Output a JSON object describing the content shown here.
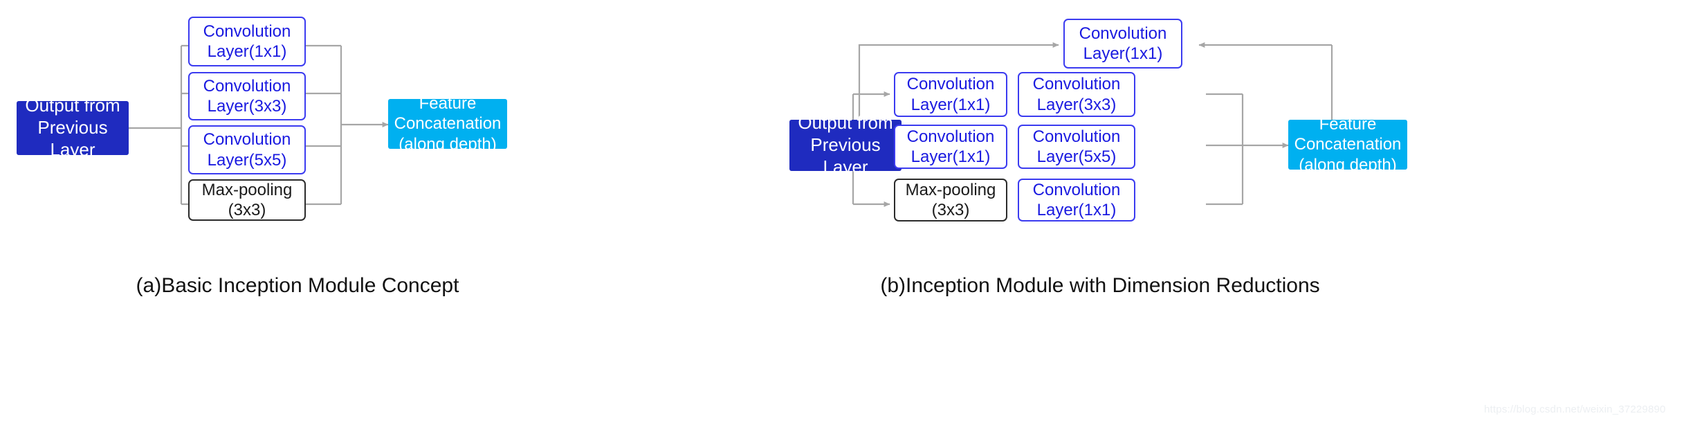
{
  "figure": {
    "watermark": "https://blog.csdn.net/weixin_37229890",
    "colors": {
      "input_block": "#1f2bbf",
      "output_block": "#00b0f0",
      "conv_border": "#3b3bf0",
      "conv_text": "#1a1ae0",
      "pool_border": "#2b2b2b",
      "wire": "#a6a6a6"
    }
  },
  "panel_a": {
    "caption": "(a)Basic Inception Module Concept",
    "input": {
      "line1": "Output from",
      "line2": "Previous Layer"
    },
    "branches": [
      {
        "line1": "Convolution",
        "line2": "Layer(1x1)",
        "style": "outline-blue"
      },
      {
        "line1": "Convolution",
        "line2": "Layer(3x3)",
        "style": "outline-blue"
      },
      {
        "line1": "Convolution",
        "line2": "Layer(5x5)",
        "style": "outline-blue"
      },
      {
        "line1": "Max-pooling",
        "line2": "(3x3)",
        "style": "outline-black"
      }
    ],
    "output": {
      "line1": "Feature",
      "line2": "Concatenation",
      "line3": "(along depth)"
    }
  },
  "panel_b": {
    "caption": "(b)Inception Module with Dimension Reductions",
    "input": {
      "line1": "Output from",
      "line2": "Previous Layer"
    },
    "top_branch": {
      "line1": "Convolution",
      "line2": "Layer(1x1)",
      "style": "outline-blue"
    },
    "rows": [
      {
        "first": {
          "line1": "Convolution",
          "line2": "Layer(1x1)",
          "style": "outline-blue"
        },
        "second": {
          "line1": "Convolution",
          "line2": "Layer(3x3)",
          "style": "outline-blue"
        }
      },
      {
        "first": {
          "line1": "Convolution",
          "line2": "Layer(1x1)",
          "style": "outline-blue"
        },
        "second": {
          "line1": "Convolution",
          "line2": "Layer(5x5)",
          "style": "outline-blue"
        }
      },
      {
        "first": {
          "line1": "Max-pooling",
          "line2": "(3x3)",
          "style": "outline-black"
        },
        "second": {
          "line1": "Convolution",
          "line2": "Layer(1x1)",
          "style": "outline-blue"
        }
      }
    ],
    "output": {
      "line1": "Feature",
      "line2": "Concatenation",
      "line3": "(along depth)"
    }
  }
}
